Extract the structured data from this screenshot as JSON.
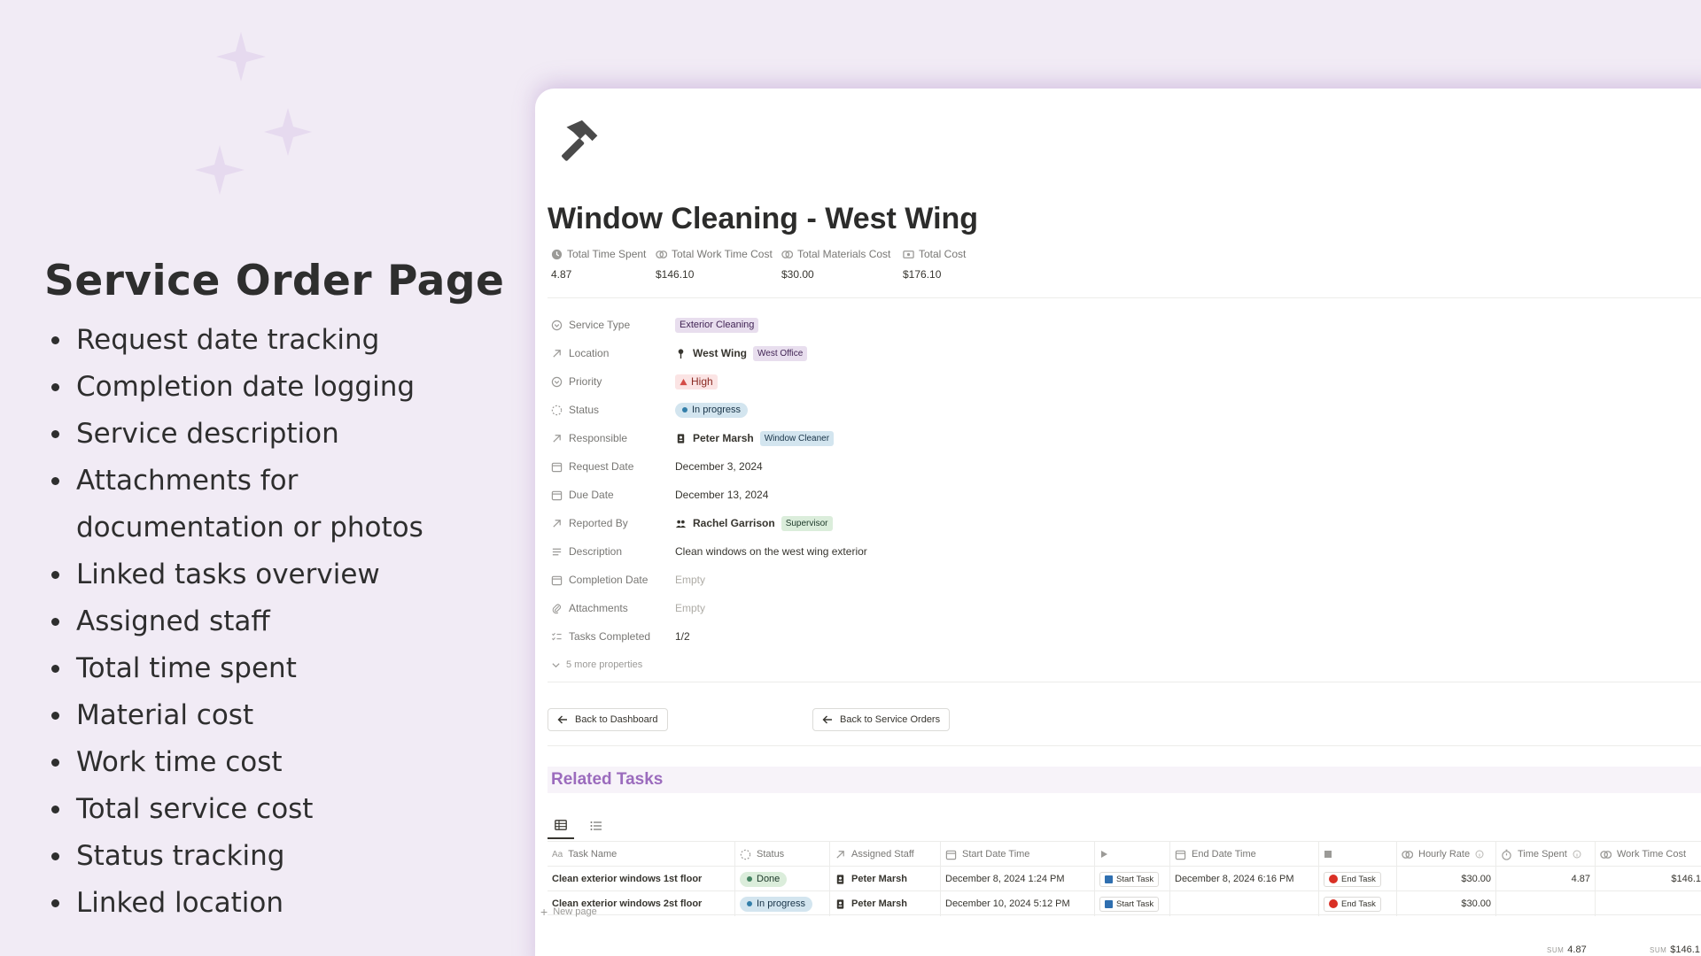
{
  "promo": {
    "title": "Service Order Page",
    "features": [
      "Request date tracking",
      "Completion date logging",
      "Service description",
      "Attachments for documentation or photos",
      "Linked tasks overview",
      "Assigned staff",
      "Total time spent",
      "Material cost",
      "Work time cost",
      "Total service cost",
      "Status tracking",
      "Linked location"
    ]
  },
  "page": {
    "icon": "hammer-icon",
    "title": "Window Cleaning - West Wing"
  },
  "summary": [
    {
      "label": "Total Time Spent",
      "value": "4.87",
      "icon": "clock-icon"
    },
    {
      "label": "Total Work Time Cost",
      "value": "$146.10",
      "icon": "coins-icon"
    },
    {
      "label": "Total Materials Cost",
      "value": "$30.00",
      "icon": "coins-icon"
    },
    {
      "label": "Total Cost",
      "value": "$176.10",
      "icon": "banknote-icon"
    }
  ],
  "properties": {
    "service_type": {
      "label": "Service Type",
      "value": "Exterior Cleaning"
    },
    "location": {
      "label": "Location",
      "value": "West Wing",
      "tag": "West Office"
    },
    "priority": {
      "label": "Priority",
      "value": "High"
    },
    "status": {
      "label": "Status",
      "value": "In progress"
    },
    "responsible": {
      "label": "Responsible",
      "value": "Peter Marsh",
      "tag": "Window Cleaner"
    },
    "request_date": {
      "label": "Request Date",
      "value": "December 3, 2024"
    },
    "due_date": {
      "label": "Due Date",
      "value": "December 13, 2024"
    },
    "reported_by": {
      "label": "Reported By",
      "value": "Rachel Garrison",
      "tag": "Supervisor"
    },
    "description": {
      "label": "Description",
      "value": "Clean windows on the west wing exterior"
    },
    "completion_date": {
      "label": "Completion Date",
      "value": "Empty"
    },
    "attachments": {
      "label": "Attachments",
      "value": "Empty"
    },
    "tasks_completed": {
      "label": "Tasks Completed",
      "value": "1/2"
    },
    "more": "5 more properties"
  },
  "buttons": {
    "back_dashboard": "Back to Dashboard",
    "back_orders": "Back to Service Orders"
  },
  "related": {
    "title": "Related Tasks",
    "columns": [
      "Task Name",
      "Status",
      "Assigned Staff",
      "Start Date Time",
      "",
      "End Date Time",
      "",
      "Hourly Rate",
      "Time Spent",
      "Work Time Cost"
    ],
    "rows": [
      {
        "task": "Clean exterior windows 1st floor",
        "status": "Done",
        "staff": "Peter Marsh",
        "start": "December 8, 2024 1:24 PM",
        "start_btn": "Start Task",
        "end": "December 8, 2024 6:16 PM",
        "end_btn": "End Task",
        "rate": "$30.00",
        "time": "4.87",
        "cost": "$146.1"
      },
      {
        "task": "Clean exterior windows 2st floor",
        "status": "In progress",
        "staff": "Peter Marsh",
        "start": "December 10, 2024 5:12 PM",
        "start_btn": "Start Task",
        "end": "",
        "end_btn": "End Task",
        "rate": "$30.00",
        "time": "",
        "cost": ""
      }
    ],
    "new_page": "New page",
    "sum_label": "SUM",
    "sum_time": "4.87",
    "sum_cost": "$146.1"
  },
  "colors": {
    "background": "#f1ebf5",
    "accent": "#9b6bbd",
    "high_priority": "#fbe4e4",
    "in_progress": "#d3e5ef",
    "done": "#dbeddb"
  }
}
